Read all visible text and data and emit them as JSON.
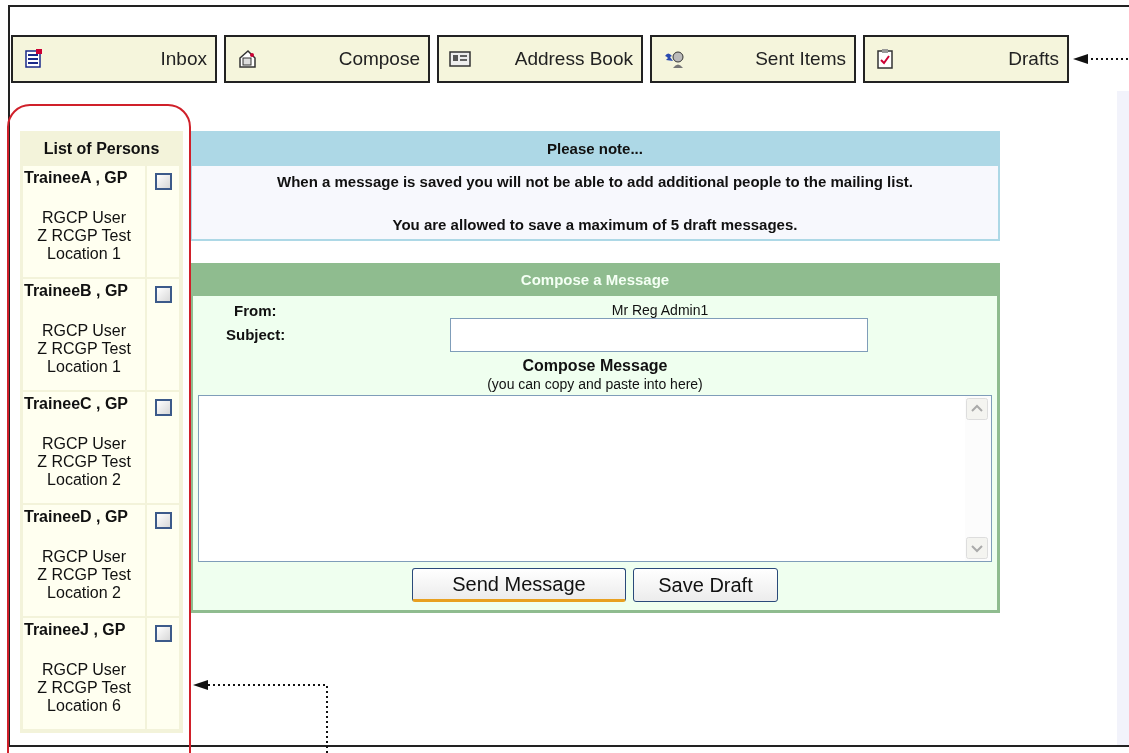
{
  "toolbar": {
    "buttons": [
      {
        "label": "Inbox"
      },
      {
        "label": "Compose"
      },
      {
        "label": "Address Book"
      },
      {
        "label": "Sent Items"
      },
      {
        "label": "Drafts"
      }
    ]
  },
  "persons": {
    "title": "List of Persons",
    "items": [
      {
        "name": "TraineeA , GP",
        "role": "RGCP User",
        "org": "Z RCGP Test",
        "location": "Location 1",
        "checked": false
      },
      {
        "name": "TraineeB , GP",
        "role": "RGCP User",
        "org": "Z RCGP Test",
        "location": "Location 1",
        "checked": false
      },
      {
        "name": "TraineeC , GP",
        "role": "RGCP User",
        "org": "Z RCGP Test",
        "location": "Location 2",
        "checked": false
      },
      {
        "name": "TraineeD , GP",
        "role": "RGCP User",
        "org": "Z RCGP Test",
        "location": "Location 2",
        "checked": false
      },
      {
        "name": "TraineeJ , GP",
        "role": "RGCP User",
        "org": "Z RCGP Test",
        "location": "Location 6",
        "checked": false
      }
    ]
  },
  "notice": {
    "title": "Please note...",
    "lines": [
      "When a message is saved you will not be able to add additional people to the mailing list.",
      "You are allowed to save a maximum of 5 draft messages."
    ]
  },
  "compose": {
    "title": "Compose a Message",
    "from_label": "From:",
    "from_value": "Mr Reg Admin1",
    "subject_label": "Subject:",
    "message_label": "Compose Message",
    "message_hint": "(you can copy and paste into here)",
    "buttons": [
      {
        "label": "Send Message",
        "kind": "default"
      },
      {
        "label": "Save Draft",
        "kind": "normal"
      }
    ]
  }
}
